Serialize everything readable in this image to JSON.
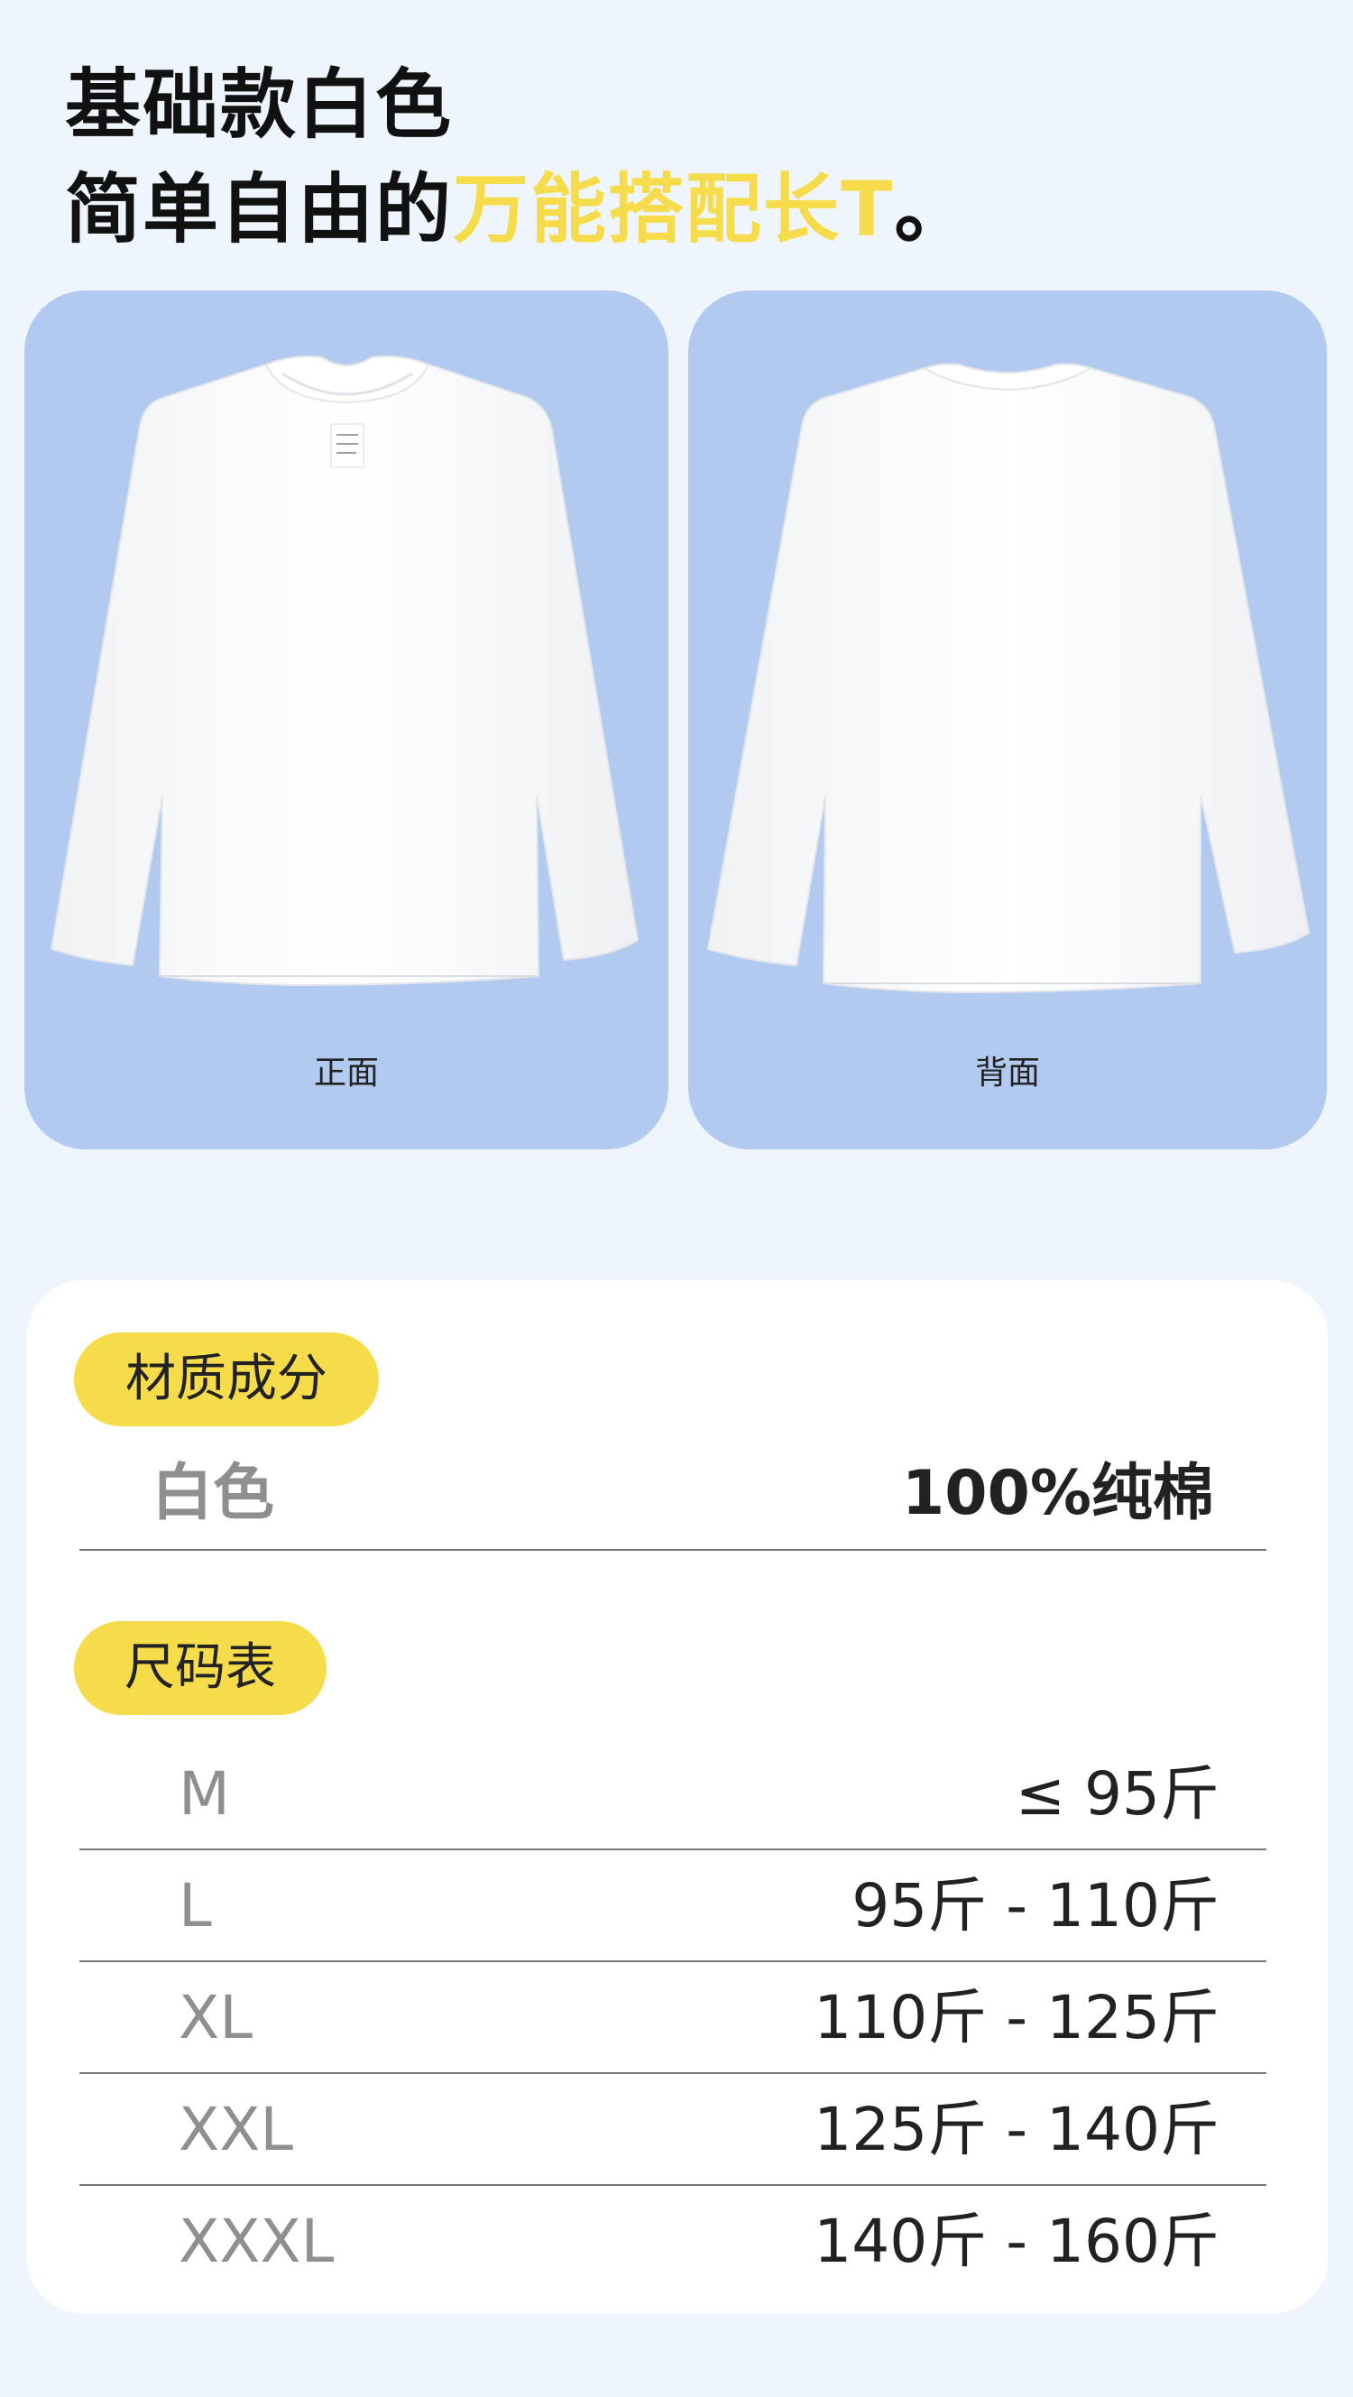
{
  "headline": {
    "line1": "基础款白色",
    "line2_prefix": "简单自由的",
    "line2_highlight": "万能搭配长T",
    "line2_suffix": "。"
  },
  "views": {
    "front_label": "正面",
    "back_label": "背面"
  },
  "material": {
    "section_title": "材质成分",
    "color": "白色",
    "composition": "100%纯棉"
  },
  "size_chart": {
    "section_title": "尺码表",
    "rows": [
      {
        "size": "M",
        "weight": "≤ 95斤"
      },
      {
        "size": "L",
        "weight": "95斤 - 110斤"
      },
      {
        "size": "XL",
        "weight": "110斤 - 125斤"
      },
      {
        "size": "XXL",
        "weight": "125斤 - 140斤"
      },
      {
        "size": "XXXL",
        "weight": "140斤 - 160斤"
      }
    ]
  },
  "colors": {
    "accent_yellow": "#f6dc4a",
    "card_blue": "#b2caf0",
    "page_bg": "#eff5fd"
  }
}
